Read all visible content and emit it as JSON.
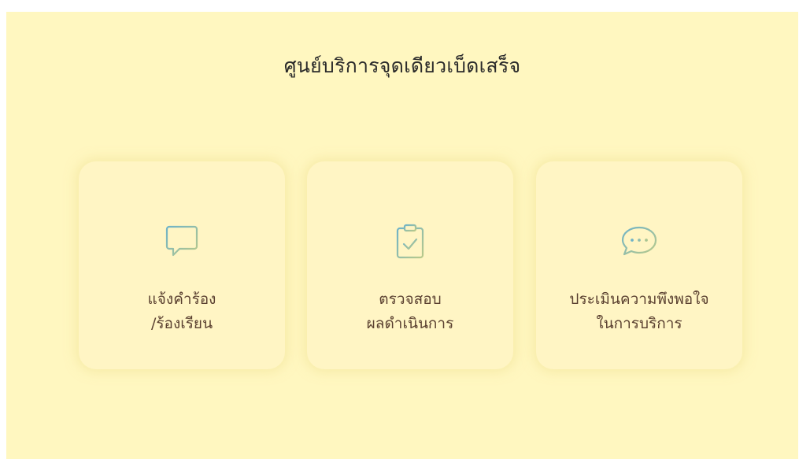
{
  "page": {
    "title": "ศูนย์บริการจุดเดียวเบ็ดเสร็จ",
    "background": "#fff7c0"
  },
  "cards": [
    {
      "icon": "message-square-icon",
      "line1": "แจ้งคำร้อง",
      "line2": "/ร้องเรียน"
    },
    {
      "icon": "clipboard-check-icon",
      "line1": "ตรวจสอบ",
      "line2": "ผลดำเนินการ"
    },
    {
      "icon": "chat-bubble-dots-icon",
      "line1": "ประเมินความพึงพอใจ",
      "line2": "ในการบริการ"
    }
  ],
  "colors": {
    "icon_gradient_start": "#6fb3c8",
    "icon_gradient_end": "#b9c98a",
    "label_text": "#5a4030",
    "title_text": "#2a2a2a"
  }
}
